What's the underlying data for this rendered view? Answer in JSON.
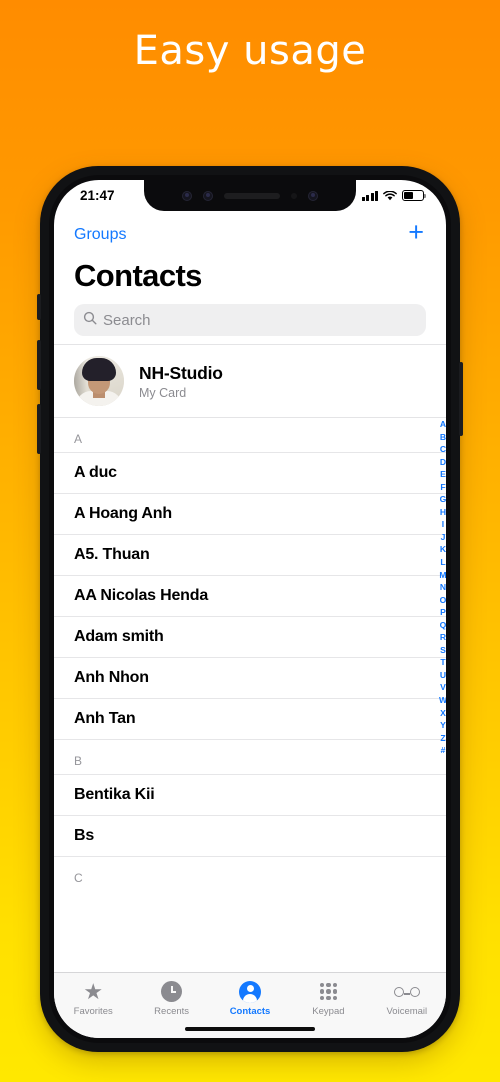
{
  "headline": "Easy usage",
  "statusbar": {
    "time": "21:47",
    "signal_icon": "signal-bars-icon",
    "wifi_icon": "wifi-icon",
    "battery_icon": "battery-icon",
    "battery_level_pct": 52
  },
  "nav": {
    "groups_label": "Groups",
    "add_label": "+"
  },
  "page_title": "Contacts",
  "search": {
    "placeholder": "Search",
    "value": "",
    "icon": "search-icon"
  },
  "my_card": {
    "name": "NH-Studio",
    "subtitle": "My Card",
    "avatar": "user-photo-avatar"
  },
  "sections": [
    {
      "letter": "A",
      "contacts": [
        "A duc",
        "A Hoang Anh",
        "A5. Thuan",
        "AA Nicolas Henda",
        "Adam smith",
        "Anh Nhon",
        "Anh Tan"
      ]
    },
    {
      "letter": "B",
      "contacts": [
        "Bentika Kii",
        "Bs"
      ]
    },
    {
      "letter": "C",
      "contacts": []
    }
  ],
  "index_letters": [
    "A",
    "B",
    "C",
    "D",
    "E",
    "F",
    "G",
    "H",
    "I",
    "J",
    "K",
    "L",
    "M",
    "N",
    "O",
    "P",
    "Q",
    "R",
    "S",
    "T",
    "U",
    "V",
    "W",
    "X",
    "Y",
    "Z",
    "#"
  ],
  "tabs": [
    {
      "label": "Favorites",
      "icon": "star-icon",
      "active": false
    },
    {
      "label": "Recents",
      "icon": "clock-icon",
      "active": false
    },
    {
      "label": "Contacts",
      "icon": "person-icon",
      "active": true
    },
    {
      "label": "Keypad",
      "icon": "keypad-icon",
      "active": false
    },
    {
      "label": "Voicemail",
      "icon": "voicemail-icon",
      "active": false
    }
  ],
  "colors": {
    "accent_blue": "#1479ff",
    "bg_gradient_top": "#FF8C00",
    "bg_gradient_bottom": "#FFE800",
    "search_field": "#efeff0",
    "secondary_text": "#8b8b90"
  }
}
